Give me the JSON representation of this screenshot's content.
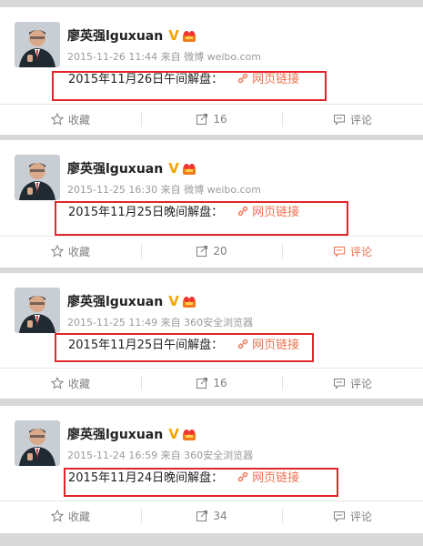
{
  "posts": [
    {
      "author": "廖英强lguxuan",
      "verified_badge": "V",
      "meta": "2015-11-26 11:44 来自 微博 weibo.com",
      "text": "2015年11月26日午间解盘：",
      "link_label": "网页链接",
      "actions": {
        "favorite": "收藏",
        "forward_count": "16",
        "comment": "评论"
      },
      "comment_highlighted": false
    },
    {
      "author": "廖英强lguxuan",
      "verified_badge": "V",
      "meta": "2015-11-25 16:30 来自 微博 weibo.com",
      "text": "2015年11月25日晚间解盘：",
      "link_label": "网页链接",
      "actions": {
        "favorite": "收藏",
        "forward_count": "20",
        "comment": "评论"
      },
      "comment_highlighted": true
    },
    {
      "author": "廖英强lguxuan",
      "verified_badge": "V",
      "meta": "2015-11-25 11:49 来自 360安全浏览器",
      "text": "2015年11月25日午间解盘：",
      "link_label": "网页链接",
      "actions": {
        "favorite": "收藏",
        "forward_count": "16",
        "comment": "评论"
      },
      "comment_highlighted": false
    },
    {
      "author": "廖英强lguxuan",
      "verified_badge": "V",
      "meta": "2015-11-24 16:59 来自 360安全浏览器",
      "text": "2015年11月24日晚间解盘：",
      "link_label": "网页链接",
      "actions": {
        "favorite": "收藏",
        "forward_count": "34",
        "comment": "评论"
      },
      "comment_highlighted": false
    }
  ],
  "colors": {
    "accent": "#eb7350",
    "highlight": "#e0262a",
    "badge": "#f5a500"
  },
  "icons": [
    "avatar-photo",
    "verified-v-icon",
    "member-icon",
    "link-clip-icon",
    "star-icon",
    "forward-icon",
    "comment-icon"
  ]
}
